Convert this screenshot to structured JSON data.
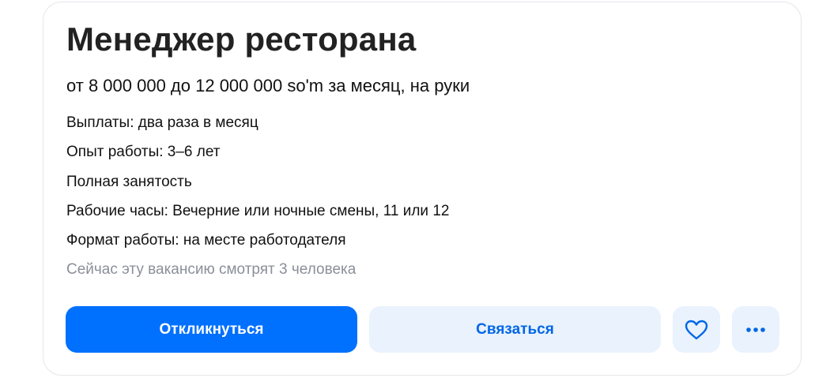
{
  "vacancy": {
    "title": "Менеджер ресторана",
    "salary": "от 8 000 000 до 12 000 000 so'm за месяц, на руки",
    "details": [
      "Выплаты: два раза в месяц",
      "Опыт работы: 3–6 лет",
      "Полная занятость",
      "Рабочие часы: Вечерние или ночные смены, 11 или 12",
      "Формат работы: на месте работодателя"
    ],
    "viewers_note": "Сейчас эту вакансию смотрят 3 человека"
  },
  "actions": {
    "respond_label": "Откликнуться",
    "contact_label": "Связаться",
    "favorite_icon": "heart-icon",
    "more_icon": "more-dots-icon"
  },
  "colors": {
    "primary": "#0070ff",
    "secondary_bg": "#e9f2fd",
    "secondary_text": "#0066e6",
    "muted_text": "#8a8f99"
  }
}
